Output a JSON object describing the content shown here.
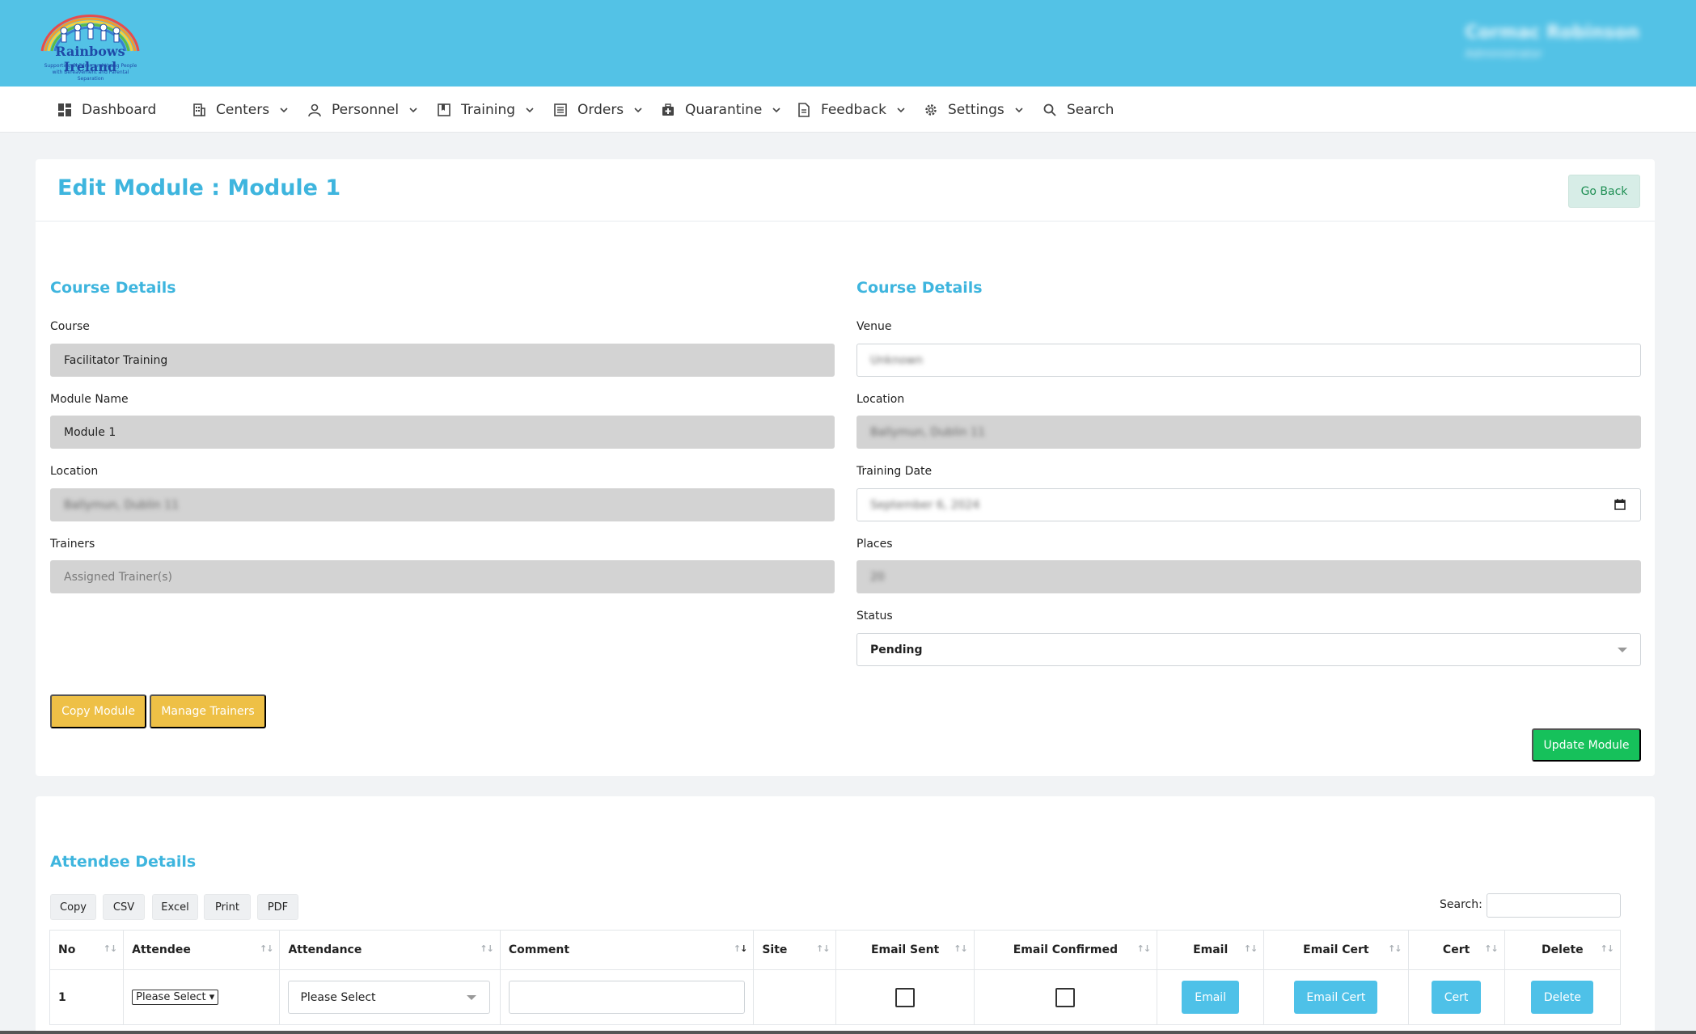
{
  "header": {
    "logo_title": "Rainbows Ireland",
    "logo_subtitle": "Supporting Children and Young People with Bereavement and Parental Separation",
    "user_name": "Cormac Robinson",
    "user_role": "Administrator"
  },
  "nav": {
    "items": [
      {
        "label": "Dashboard",
        "icon": "dashboard-icon",
        "dropdown": false
      },
      {
        "label": "Centers",
        "icon": "building-icon",
        "dropdown": true
      },
      {
        "label": "Personnel",
        "icon": "person-icon",
        "dropdown": true
      },
      {
        "label": "Training",
        "icon": "book-icon",
        "dropdown": true
      },
      {
        "label": "Orders",
        "icon": "list-icon",
        "dropdown": true
      },
      {
        "label": "Quarantine",
        "icon": "medkit-icon",
        "dropdown": true
      },
      {
        "label": "Feedback",
        "icon": "document-icon",
        "dropdown": true
      },
      {
        "label": "Settings",
        "icon": "gear-icon",
        "dropdown": true
      },
      {
        "label": "Search",
        "icon": "search-icon",
        "dropdown": false
      }
    ]
  },
  "page": {
    "title": "Edit Module : Module 1",
    "go_back": "Go Back"
  },
  "left": {
    "section_title": "Course Details",
    "course_label": "Course",
    "course_value": "Facilitator Training",
    "module_name_label": "Module Name",
    "module_name_value": "Module 1",
    "location_label": "Location",
    "location_value": "Ballymun, Dublin 11",
    "trainers_label": "Trainers",
    "trainers_placeholder": "Assigned Trainer(s)",
    "copy_module": "Copy Module",
    "manage_trainers": "Manage Trainers"
  },
  "right": {
    "section_title": "Course Details",
    "venue_label": "Venue",
    "venue_value": "Unknown",
    "location_label": "Location",
    "location_value": "Ballymun, Dublin 11",
    "training_date_label": "Training Date",
    "training_date_value": "September 6, 2024",
    "places_label": "Places",
    "places_value": "20",
    "status_label": "Status",
    "status_value": "Pending",
    "update_module": "Update Module"
  },
  "attendees": {
    "section_title": "Attendee Details",
    "export_buttons": [
      "Copy",
      "CSV",
      "Excel",
      "Print",
      "PDF"
    ],
    "search_label": "Search:",
    "columns": [
      "No",
      "Attendee",
      "Attendance",
      "Comment",
      "Site",
      "Email Sent",
      "Email Confirmed",
      "Email",
      "Email Cert",
      "Cert",
      "Delete"
    ],
    "rows": [
      {
        "no": "1",
        "attendee": "Please Select",
        "attendance": "Please Select",
        "email_btn": "Email",
        "email_cert_btn": "Email Cert",
        "cert_btn": "Cert",
        "delete_btn": "Delete"
      }
    ]
  },
  "colors": {
    "header": "#53c2e6",
    "accent": "#3eb5de",
    "yellow": "#eec046",
    "green": "#16c15b",
    "blue_button": "#4ec1e8"
  }
}
